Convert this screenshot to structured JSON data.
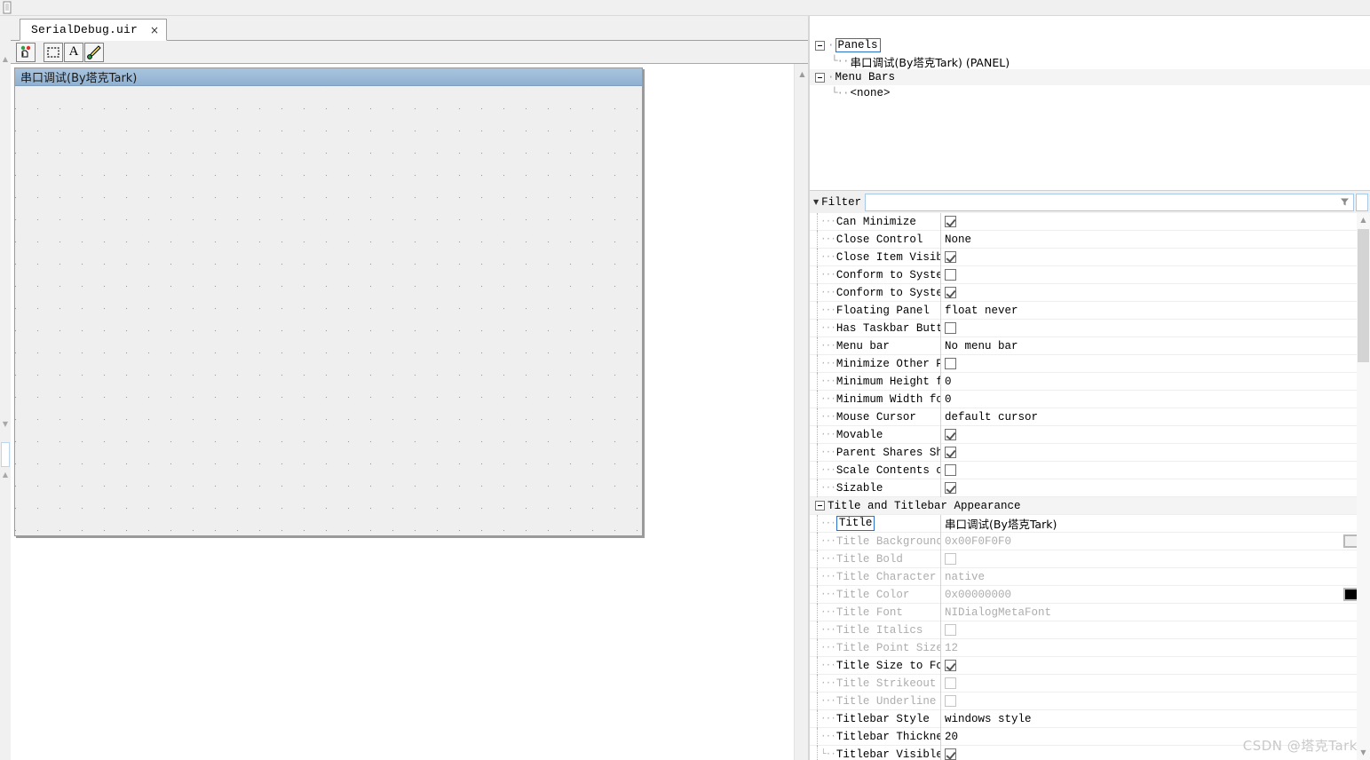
{
  "app": {
    "watermark": "CSDN @塔克Tark"
  },
  "tab": {
    "label": "SerialDebug.uir",
    "close": "×"
  },
  "toolbar": {
    "buttons": [
      {
        "name": "operate-tool",
        "label": ""
      },
      {
        "name": "select-tool",
        "label": ""
      },
      {
        "name": "text-tool",
        "label": "A"
      },
      {
        "name": "color-tool",
        "label": ""
      }
    ]
  },
  "designer": {
    "panel_title": "串口调试(By塔克Tark)"
  },
  "tree": {
    "nodes": [
      {
        "label": "Panels",
        "expander": true,
        "selected": true,
        "indent": 0,
        "shaded": false
      },
      {
        "label": "串口调试(By塔克Tark) (PANEL)",
        "expander": false,
        "selected": false,
        "indent": 1,
        "shaded": false,
        "cjk": true
      },
      {
        "label": "Menu Bars",
        "expander": true,
        "selected": false,
        "indent": 0,
        "shaded": true
      },
      {
        "label": "<none>",
        "expander": false,
        "selected": false,
        "indent": 1,
        "shaded": false
      }
    ]
  },
  "filter": {
    "label": "Filter",
    "value": "",
    "placeholder": ""
  },
  "properties": {
    "rows": [
      {
        "name": "Can Minimize",
        "type": "checkbox",
        "value": true,
        "disabled": false
      },
      {
        "name": "Close Control",
        "type": "text",
        "value": "None",
        "disabled": false
      },
      {
        "name": "Close Item Visible",
        "type": "checkbox",
        "value": true,
        "disabled": false
      },
      {
        "name": "Conform to System Colors",
        "type": "checkbox",
        "value": false,
        "disabled": false
      },
      {
        "name": "Conform to System Theme",
        "type": "checkbox",
        "value": true,
        "disabled": false
      },
      {
        "name": "Floating Panel",
        "type": "text",
        "value": "float never",
        "disabled": false
      },
      {
        "name": "Has Taskbar Button",
        "type": "checkbox",
        "value": false,
        "disabled": false
      },
      {
        "name": "Menu bar",
        "type": "text",
        "value": "No menu bar",
        "disabled": false
      },
      {
        "name": "Minimize Other Panels",
        "type": "checkbox",
        "value": false,
        "disabled": false
      },
      {
        "name": "Minimum Height for Scaling",
        "type": "text",
        "value": "0",
        "disabled": false
      },
      {
        "name": "Minimum Width for Scaling",
        "type": "text",
        "value": "0",
        "disabled": false
      },
      {
        "name": "Mouse Cursor",
        "type": "text",
        "value": "default cursor",
        "disabled": false
      },
      {
        "name": "Movable",
        "type": "checkbox",
        "value": true,
        "disabled": false
      },
      {
        "name": "Parent Shares Shortcut",
        "type": "checkbox",
        "value": true,
        "disabled": false
      },
      {
        "name": "Scale Contents on Resize",
        "type": "checkbox",
        "value": false,
        "disabled": false
      },
      {
        "name": "Sizable",
        "type": "checkbox",
        "value": true,
        "disabled": false
      },
      {
        "name": "Title and Titlebar Appearance",
        "type": "group",
        "value": "",
        "disabled": false
      },
      {
        "name": "Title",
        "type": "text",
        "value": "串口调试(By塔克Tark)",
        "disabled": false,
        "focused": true,
        "cjk": true
      },
      {
        "name": "Title Background Color",
        "type": "color",
        "value": "0x00F0F0F0",
        "disabled": true,
        "swatch": "#f0f0f0"
      },
      {
        "name": "Title Bold",
        "type": "checkbox",
        "value": false,
        "disabled": true
      },
      {
        "name": "Title Character Set",
        "type": "text",
        "value": "native",
        "disabled": true
      },
      {
        "name": "Title Color",
        "type": "color",
        "value": "0x00000000",
        "disabled": true,
        "swatch": "#000000"
      },
      {
        "name": "Title Font",
        "type": "text",
        "value": "NIDialogMetaFont",
        "disabled": true
      },
      {
        "name": "Title Italics",
        "type": "checkbox",
        "value": false,
        "disabled": true
      },
      {
        "name": "Title Point Size",
        "type": "text",
        "value": "12",
        "disabled": true
      },
      {
        "name": "Title Size to Font",
        "type": "checkbox",
        "value": true,
        "disabled": false
      },
      {
        "name": "Title Strikeout",
        "type": "checkbox",
        "value": false,
        "disabled": true
      },
      {
        "name": "Title Underline",
        "type": "checkbox",
        "value": false,
        "disabled": true
      },
      {
        "name": "Titlebar Style",
        "type": "text",
        "value": "windows style",
        "disabled": false
      },
      {
        "name": "Titlebar Thickness",
        "type": "text",
        "value": "20",
        "disabled": false
      },
      {
        "name": "Titlebar Visible",
        "type": "checkbox",
        "value": true,
        "disabled": false
      }
    ]
  }
}
